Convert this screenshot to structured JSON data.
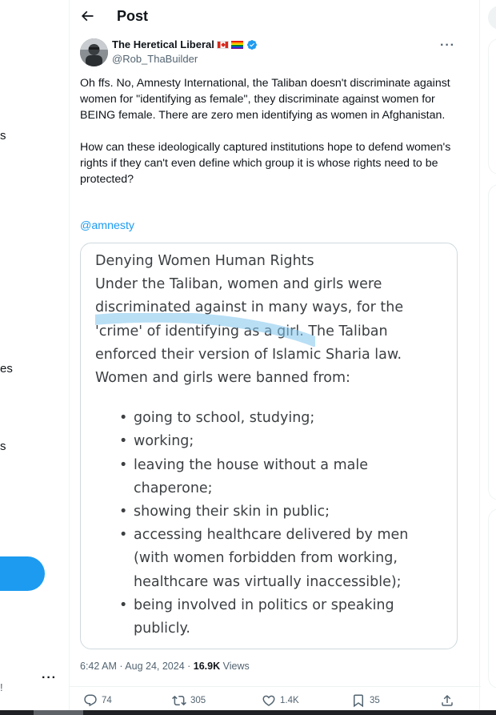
{
  "left_nav": {
    "fragments": [
      "s",
      "es",
      "s"
    ],
    "account_more": "···",
    "account_fragment": "!"
  },
  "header": {
    "title": "Post"
  },
  "tweet": {
    "author": {
      "name": "The Heretical Liberal",
      "handle": "@Rob_ThaBuilder",
      "verified": true
    },
    "paragraphs": [
      "Oh ffs. No, Amnesty International, the Taliban doesn't discriminate against women for \"identifying as female\", they discriminate against women for BEING female. There are zero men identifying as women in Afghanistan.",
      "How can these ideologically captured institutions hope to defend women's rights if they can't even define which group it is whose rights need to be protected?"
    ],
    "mention": "@amnesty",
    "media": {
      "title": "Denying Women Human Rights",
      "body": "Under the Taliban, women and girls were discriminated against in many ways, for the 'crime' of identifying as a girl. The Taliban enforced their version of Islamic Sharia law. Women and girls were banned from:",
      "list": [
        "going to school, studying;",
        "working;",
        "leaving the house without a male chaperone;",
        "showing their skin in public;",
        "accessing healthcare delivered by men (with women forbidden from working, healthcare was virtually inaccessible);",
        "being involved in politics or speaking publicly."
      ]
    },
    "timestamp": "6:42 AM · Aug 24, 2024 · ",
    "views_count": "16.9K",
    "views_label": " Views",
    "stats": {
      "replies": "74",
      "reposts": "305",
      "likes": "1.4K",
      "bookmarks": "35"
    }
  },
  "colors": {
    "accent": "#1d9bf0",
    "text": "#0f1419",
    "secondary": "#536471",
    "repost": "#00ba7c"
  },
  "icons": {
    "back": "back-arrow-icon",
    "more": "more-icon",
    "verified": "verified-badge-icon",
    "reply": "reply-icon",
    "repost": "repost-icon",
    "like": "like-icon",
    "bookmark": "bookmark-icon",
    "share": "share-icon"
  }
}
